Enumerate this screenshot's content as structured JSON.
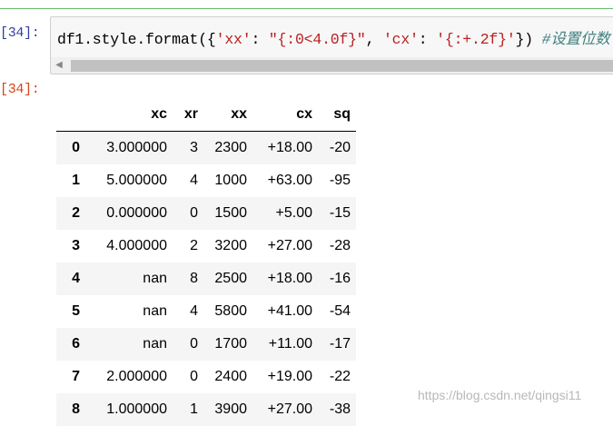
{
  "cell": {
    "in_prompt": "[34]:",
    "out_prompt": "[34]:",
    "code": {
      "part1": "df1.style.format({",
      "str_xx_key": "'xx'",
      "colon1": ": ",
      "str_xx_fmt": "\"{:0<4.0f}\"",
      "comma": ", ",
      "str_cx_key": "'cx'",
      "colon2": ": ",
      "str_cx_fmt": "'{:+.2f}'",
      "part_end": "}) ",
      "comment": "#设置位数"
    },
    "scrollbar": {
      "arrow_left": "◀"
    }
  },
  "table": {
    "columns": [
      "",
      "xc",
      "xr",
      "xx",
      "cx",
      "sq"
    ],
    "rows": [
      {
        "index": "0",
        "xc": "3.000000",
        "xr": "3",
        "xx": "2300",
        "cx": "+18.00",
        "sq": "-20"
      },
      {
        "index": "1",
        "xc": "5.000000",
        "xr": "4",
        "xx": "1000",
        "cx": "+63.00",
        "sq": "-95"
      },
      {
        "index": "2",
        "xc": "0.000000",
        "xr": "0",
        "xx": "1500",
        "cx": "+5.00",
        "sq": "-15"
      },
      {
        "index": "3",
        "xc": "4.000000",
        "xr": "2",
        "xx": "3200",
        "cx": "+27.00",
        "sq": "-28"
      },
      {
        "index": "4",
        "xc": "nan",
        "xr": "8",
        "xx": "2500",
        "cx": "+18.00",
        "sq": "-16"
      },
      {
        "index": "5",
        "xc": "nan",
        "xr": "4",
        "xx": "5800",
        "cx": "+41.00",
        "sq": "-54"
      },
      {
        "index": "6",
        "xc": "nan",
        "xr": "0",
        "xx": "1700",
        "cx": "+11.00",
        "sq": "-17"
      },
      {
        "index": "7",
        "xc": "2.000000",
        "xr": "0",
        "xx": "2400",
        "cx": "+19.00",
        "sq": "-22"
      },
      {
        "index": "8",
        "xc": "1.000000",
        "xr": "1",
        "xx": "3900",
        "cx": "+27.00",
        "sq": "-38"
      }
    ]
  },
  "watermark": "https://blog.csdn.net/qingsi11",
  "colors": {
    "in_prompt": "#303f9f",
    "out_prompt": "#d84315",
    "string": "#ba2121",
    "comment": "#408080",
    "row_stripe": "#f5f5f5"
  }
}
